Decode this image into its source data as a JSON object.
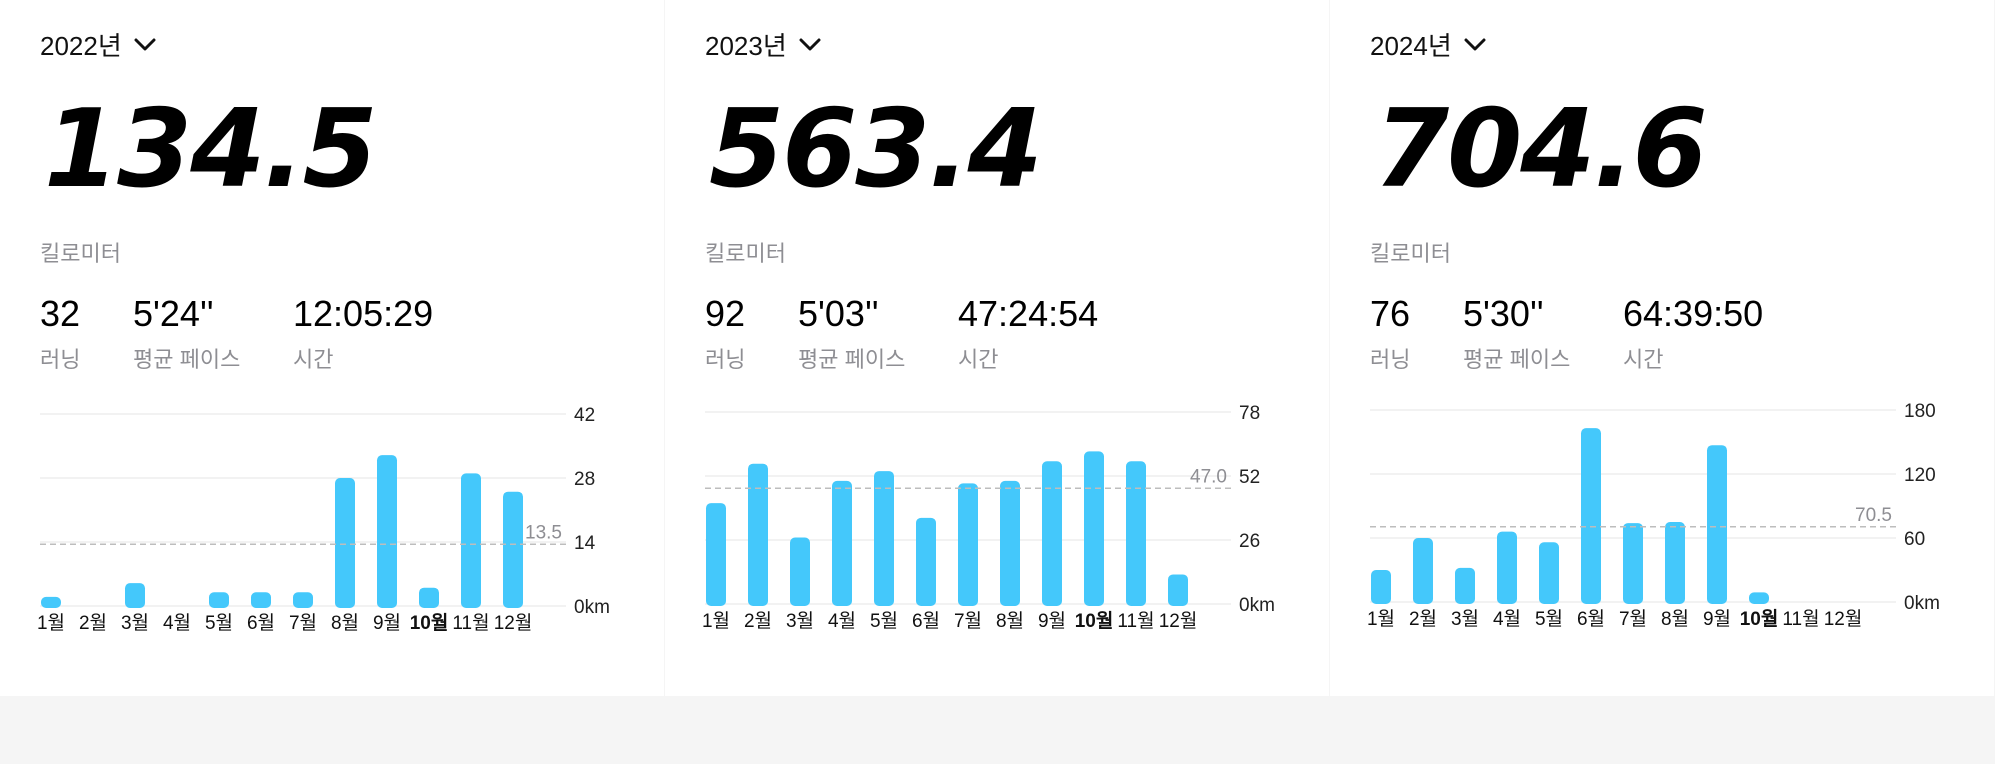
{
  "panels": [
    {
      "year": "2022년",
      "distance": "134.5",
      "unit": "킬로미터",
      "stats": [
        {
          "value": "32",
          "label": "러닝"
        },
        {
          "value": "5'24''",
          "label": "평균 페이스"
        },
        {
          "value": "12:05:29",
          "label": "시간"
        }
      ]
    },
    {
      "year": "2023년",
      "distance": "563.4",
      "unit": "킬로미터",
      "stats": [
        {
          "value": "92",
          "label": "러닝"
        },
        {
          "value": "5'03''",
          "label": "평균 페이스"
        },
        {
          "value": "47:24:54",
          "label": "시간"
        }
      ]
    },
    {
      "year": "2024년",
      "distance": "704.6",
      "unit": "킬로미터",
      "stats": [
        {
          "value": "76",
          "label": "러닝"
        },
        {
          "value": "5'30''",
          "label": "평균 페이스"
        },
        {
          "value": "64:39:50",
          "label": "시간"
        }
      ]
    }
  ],
  "colors": {
    "bar": "#44c8fb",
    "grid": "#e6e6e6",
    "avg_line": "#bdbdbd",
    "muted_text": "#8e8e93"
  },
  "chart_data": [
    {
      "type": "bar",
      "categories": [
        "1월",
        "2월",
        "3월",
        "4월",
        "5월",
        "6월",
        "7월",
        "8월",
        "9월",
        "10월",
        "11월",
        "12월"
      ],
      "values": [
        2,
        0,
        5,
        0,
        3,
        3,
        3,
        28,
        33,
        4,
        29,
        25
      ],
      "ylim": [
        0,
        42
      ],
      "ticks": [
        "0km",
        "14",
        "28",
        "42"
      ],
      "tick_values": [
        0,
        14,
        28,
        42
      ],
      "average": 13.5,
      "average_label": "13.5",
      "highlight_category": "10월"
    },
    {
      "type": "bar",
      "categories": [
        "1월",
        "2월",
        "3월",
        "4월",
        "5월",
        "6월",
        "7월",
        "8월",
        "9월",
        "10월",
        "11월",
        "12월"
      ],
      "values": [
        41,
        57,
        27,
        50,
        54,
        35,
        49,
        50,
        58,
        62,
        58,
        12
      ],
      "ylim": [
        0,
        78
      ],
      "ticks": [
        "0km",
        "26",
        "52",
        "78"
      ],
      "tick_values": [
        0,
        26,
        52,
        78
      ],
      "average": 47.0,
      "average_label": "47.0",
      "highlight_category": "10월"
    },
    {
      "type": "bar",
      "categories": [
        "1월",
        "2월",
        "3월",
        "4월",
        "5월",
        "6월",
        "7월",
        "8월",
        "9월",
        "10월",
        "11월",
        "12월"
      ],
      "values": [
        30,
        60,
        32,
        66,
        56,
        163,
        74,
        75,
        147,
        9,
        0,
        0
      ],
      "ylim": [
        0,
        180
      ],
      "ticks": [
        "0km",
        "60",
        "120",
        "180"
      ],
      "tick_values": [
        0,
        60,
        120,
        180
      ],
      "average": 70.5,
      "average_label": "70.5",
      "highlight_category": "10월"
    }
  ]
}
